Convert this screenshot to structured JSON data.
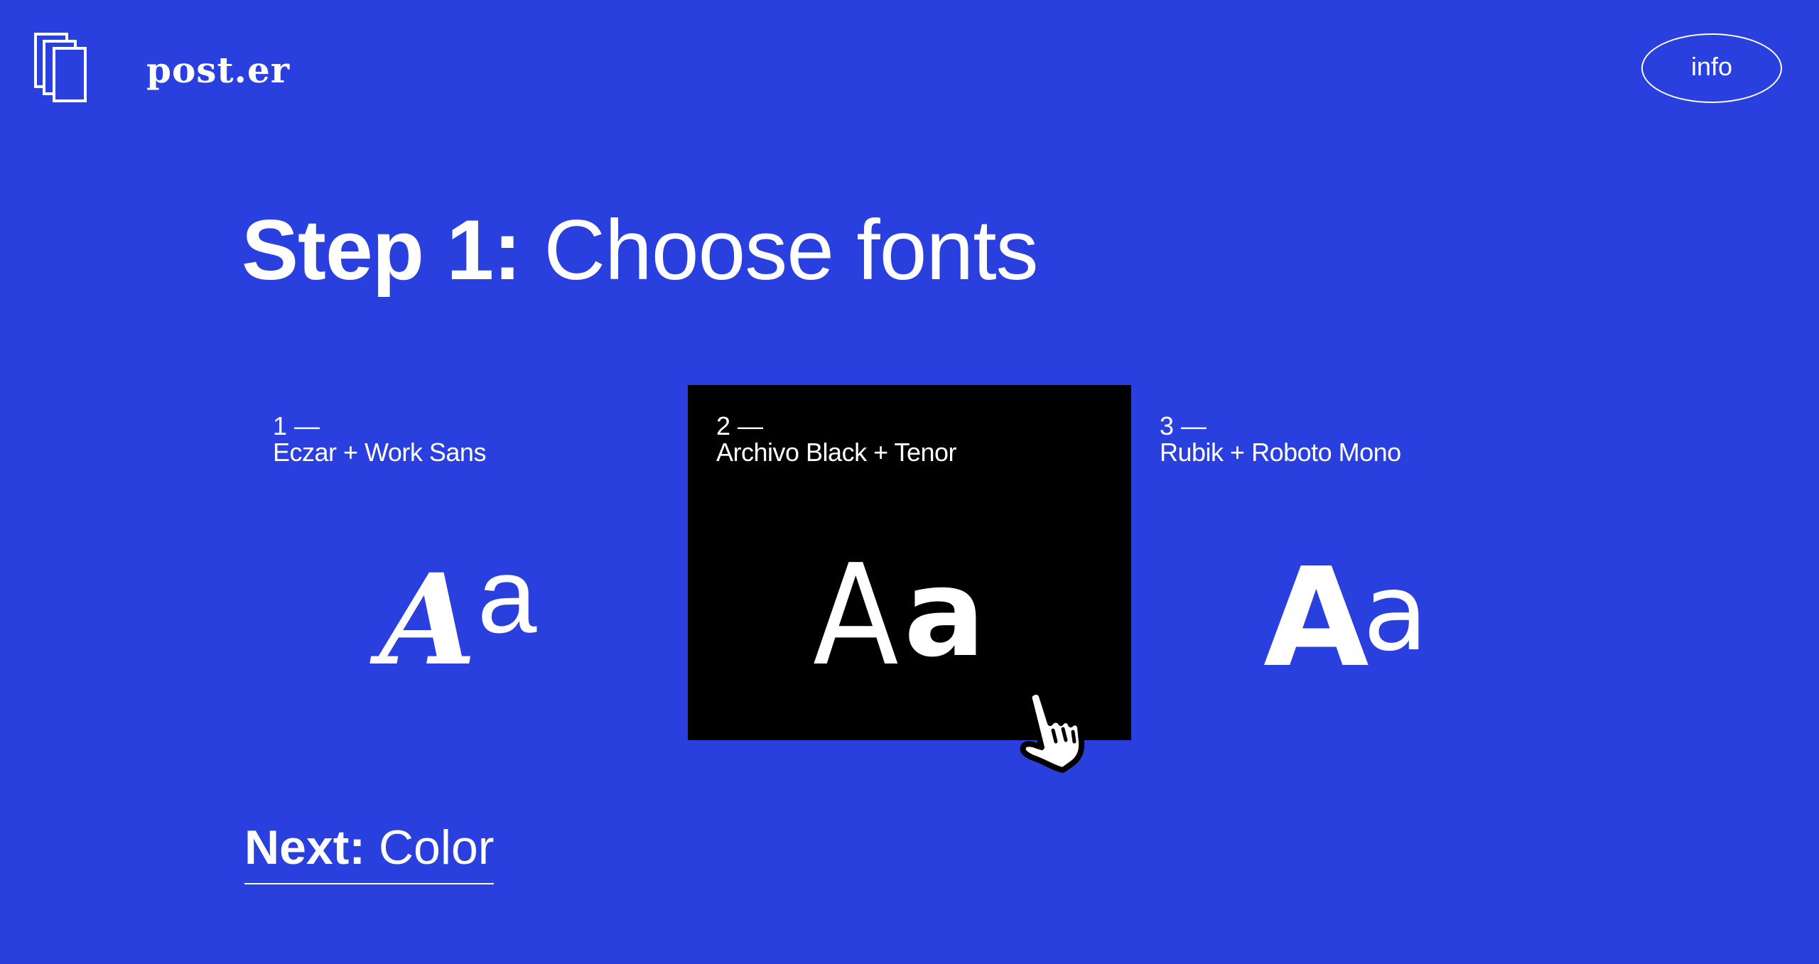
{
  "header": {
    "logo_text": "post.er",
    "info_label": "info"
  },
  "title": {
    "step": "Step 1:",
    "text": "Choose fonts"
  },
  "options": [
    {
      "number": "1 —",
      "name": "Eczar + Work Sans",
      "specimen_upper": "A",
      "specimen_lower": "a",
      "selected": false
    },
    {
      "number": "2 —",
      "name": "Archivo Black + Tenor",
      "specimen_upper": "A",
      "specimen_lower": "a",
      "selected": true
    },
    {
      "number": "3 —",
      "name": "Rubik + Roboto Mono",
      "specimen_upper": "A",
      "specimen_lower": "a",
      "selected": false
    }
  ],
  "next": {
    "label": "Next:",
    "target": "Color"
  },
  "icons": {
    "logo": "stacked-pages-icon",
    "cursor": "hand-pointer-cursor-icon"
  },
  "colors": {
    "background": "#2a40de",
    "text": "#ffffff",
    "selected_card": "#000000"
  }
}
